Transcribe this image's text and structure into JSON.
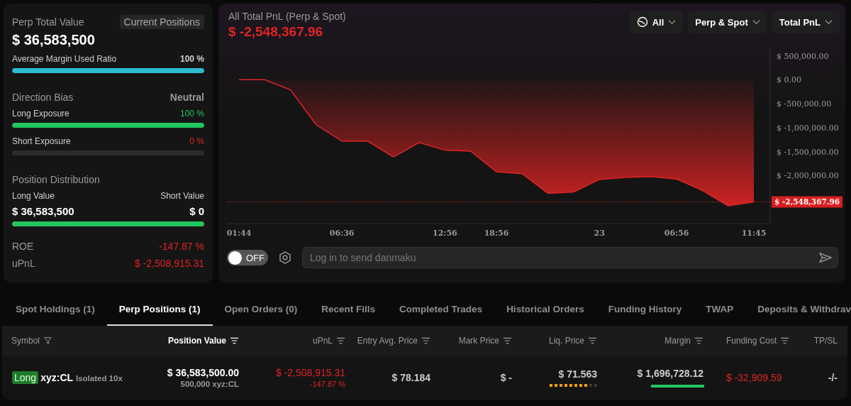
{
  "summary": {
    "title": "Perp Total Value",
    "badge": "Current Positions",
    "value": "$ 36,583,500",
    "margin_ratio": {
      "label": "Average Margin Used Ratio",
      "reading": "100 %",
      "level": 1
    },
    "direction": {
      "title": "Direction Bias",
      "value": "Neutral"
    },
    "exposures": [
      {
        "kind": "long",
        "label": "Long Exposure",
        "reading": "100 %",
        "level": 1
      },
      {
        "kind": "short",
        "label": "Short Exposure",
        "reading": "0 %",
        "level": 0
      }
    ],
    "distribution": {
      "title": "Position Distribution",
      "long_label": "Long Value",
      "short_label": "Short Value",
      "long_value": "$ 36,583,500",
      "short_value": "$ 0",
      "level": 1
    },
    "metrics": [
      {
        "label": "ROE",
        "value": "-147.87 %",
        "negative": true
      },
      {
        "label": "uPnL",
        "value": "$ -2,508,915.31",
        "negative": true
      }
    ]
  },
  "chart_panel": {
    "title": "All Total PnL (Perp & Spot)",
    "value": "$ -2,548,367.96",
    "dropdowns": [
      {
        "label": "All"
      },
      {
        "label": "Perp & Spot"
      },
      {
        "label": "Total PnL"
      }
    ],
    "chart_data": {
      "type": "area",
      "categories": [
        "01:44",
        null,
        null,
        null,
        "06:36",
        null,
        null,
        null,
        "12:56",
        null,
        "18:56",
        null,
        null,
        null,
        "23",
        null,
        null,
        "06:56",
        null,
        null,
        "11:45"
      ],
      "series": [
        {
          "color": "#e02424",
          "values": [
            0,
            0,
            -210000,
            -940000,
            -1280000,
            -1280000,
            -1610000,
            -1310000,
            -1470000,
            -1490000,
            -1920000,
            -1960000,
            -2370000,
            -2340000,
            -2080000,
            -2040000,
            -2020000,
            -2070000,
            -2310000,
            -2630000,
            -2548367.96
          ]
        }
      ],
      "ylim": [
        -3000000,
        700000
      ],
      "yticks": [
        {
          "value": 500000,
          "label": "$ 500,000.00"
        },
        {
          "value": 0,
          "label": "$ 0.00"
        },
        {
          "value": -500000,
          "label": "$ -500,000.00"
        },
        {
          "value": -1000000,
          "label": "$ -1,000,000.00"
        },
        {
          "value": -1500000,
          "label": "$ -1,500,000.00"
        },
        {
          "value": -2000000,
          "label": "$ -2,000,000.00"
        }
      ],
      "ref_lines": [
        {
          "axis": "y",
          "value": -2548367.96,
          "label": "$ -2,548,367.96"
        }
      ]
    },
    "danmaku": {
      "toggle": {
        "label": "OFF",
        "on": false
      },
      "placeholder": "Log in to send danmaku"
    }
  },
  "tabs": [
    {
      "label": "Spot Holdings (1)",
      "selected": false
    },
    {
      "label": "Perp Positions (1)",
      "selected": true
    },
    {
      "label": "Open Orders (0)",
      "selected": false
    },
    {
      "label": "Recent Fills",
      "selected": false
    },
    {
      "label": "Completed Trades",
      "selected": false
    },
    {
      "label": "Historical Orders",
      "selected": false
    },
    {
      "label": "Funding History",
      "selected": false
    },
    {
      "label": "TWAP",
      "selected": false
    },
    {
      "label": "Deposits & Withdrav",
      "selected": false
    }
  ],
  "table": {
    "columns": [
      {
        "label": "Symbol",
        "kind": "filter",
        "sorted": false
      },
      {
        "label": "Position Value",
        "kind": "sort",
        "sorted": true
      },
      {
        "label": "uPnL",
        "kind": "sort",
        "sorted": false
      },
      {
        "label": "Entry Avg. Price",
        "kind": "sort",
        "sorted": false
      },
      {
        "label": "Mark Price",
        "kind": "sort",
        "sorted": false
      },
      {
        "label": "Liq. Price",
        "kind": "sort",
        "sorted": false
      },
      {
        "label": "Margin",
        "kind": "sort",
        "sorted": false
      },
      {
        "label": "Funding Cost",
        "kind": "sort",
        "sorted": false
      },
      {
        "label": "TP/SL",
        "kind": "plain",
        "sorted": false
      }
    ],
    "rows": [
      {
        "side": "Long",
        "symbol": "xyz:CL",
        "mode": "Isolated 10x",
        "position_value": "$ 36,583,500.00",
        "position_size": "500,000 xyz:CL",
        "upnl": "$ -2,508,915.31",
        "upnl_pct": "-147.87 %",
        "entry_price": "$ 78.184",
        "mark_price": "$ -",
        "liq": {
          "price": "$ 71.563",
          "level": 0.8
        },
        "margin": {
          "value": "$ 1,696,728.12",
          "level": 1
        },
        "funding_cost": "$ -32,909.59",
        "tpsl": "-/-"
      }
    ]
  }
}
